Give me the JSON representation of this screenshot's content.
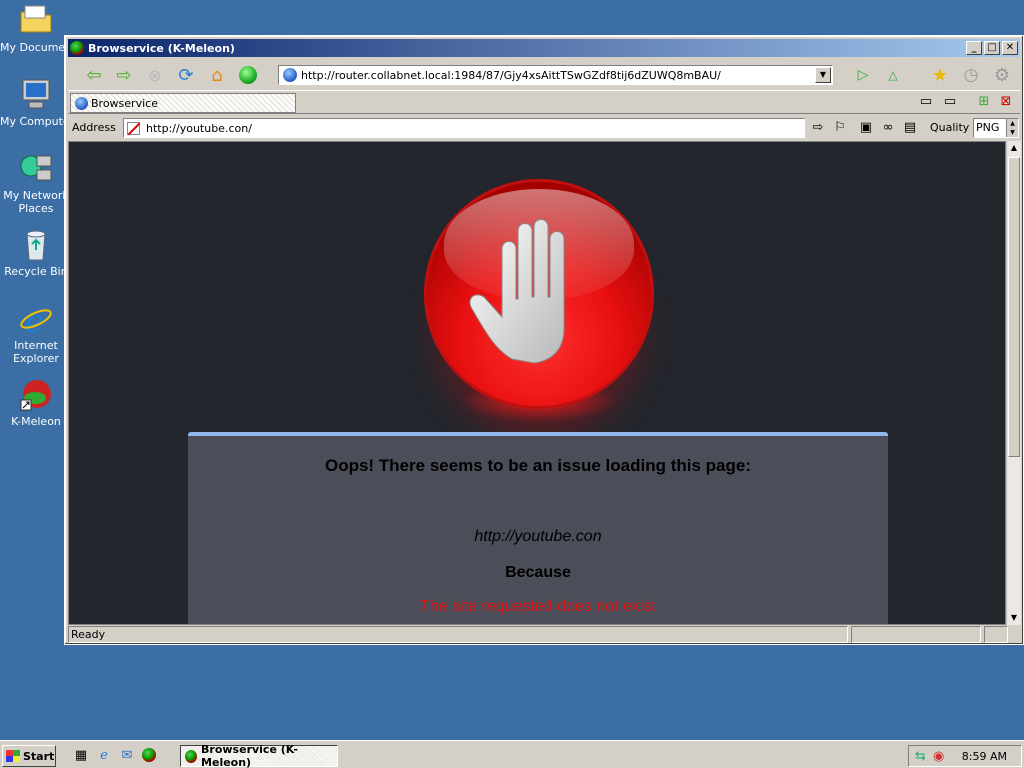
{
  "desktop": {
    "icons": [
      {
        "label": "My Documents"
      },
      {
        "label": "My Computer"
      },
      {
        "label": "My Network Places"
      },
      {
        "label": "Recycle Bin"
      },
      {
        "label": "Internet Explorer"
      },
      {
        "label": "K-Meleon"
      }
    ]
  },
  "window": {
    "title": "Browservice (K-Meleon)",
    "minimize": "_",
    "maximize": "□",
    "close": "✕"
  },
  "toolbar": {
    "url": "http://router.collabnet.local:1984/87/Gjy4xsAittTSwGZdf8tij6dZUWQ8mBAU/"
  },
  "tab": {
    "label": "Browservice"
  },
  "address": {
    "label": "Address",
    "value": "http://youtube.con/",
    "quality_label": "Quality",
    "quality_value": "PNG"
  },
  "page": {
    "heading": "Oops! There seems to be an issue loading this page:",
    "failed_url": "http://youtube.con",
    "because": "Because",
    "reason": "The site requested does not exist"
  },
  "status": {
    "text": "Ready"
  },
  "taskbar": {
    "start": "Start",
    "task_label": "Browservice (K-Meleon)",
    "clock": "8:59 AM"
  },
  "colors": {
    "desktop": "#3a6ea5",
    "page_bg": "#23262d",
    "panel_bg": "#4b4e59",
    "panel_accent": "#8fb8e8",
    "error_red": "#e01010"
  }
}
